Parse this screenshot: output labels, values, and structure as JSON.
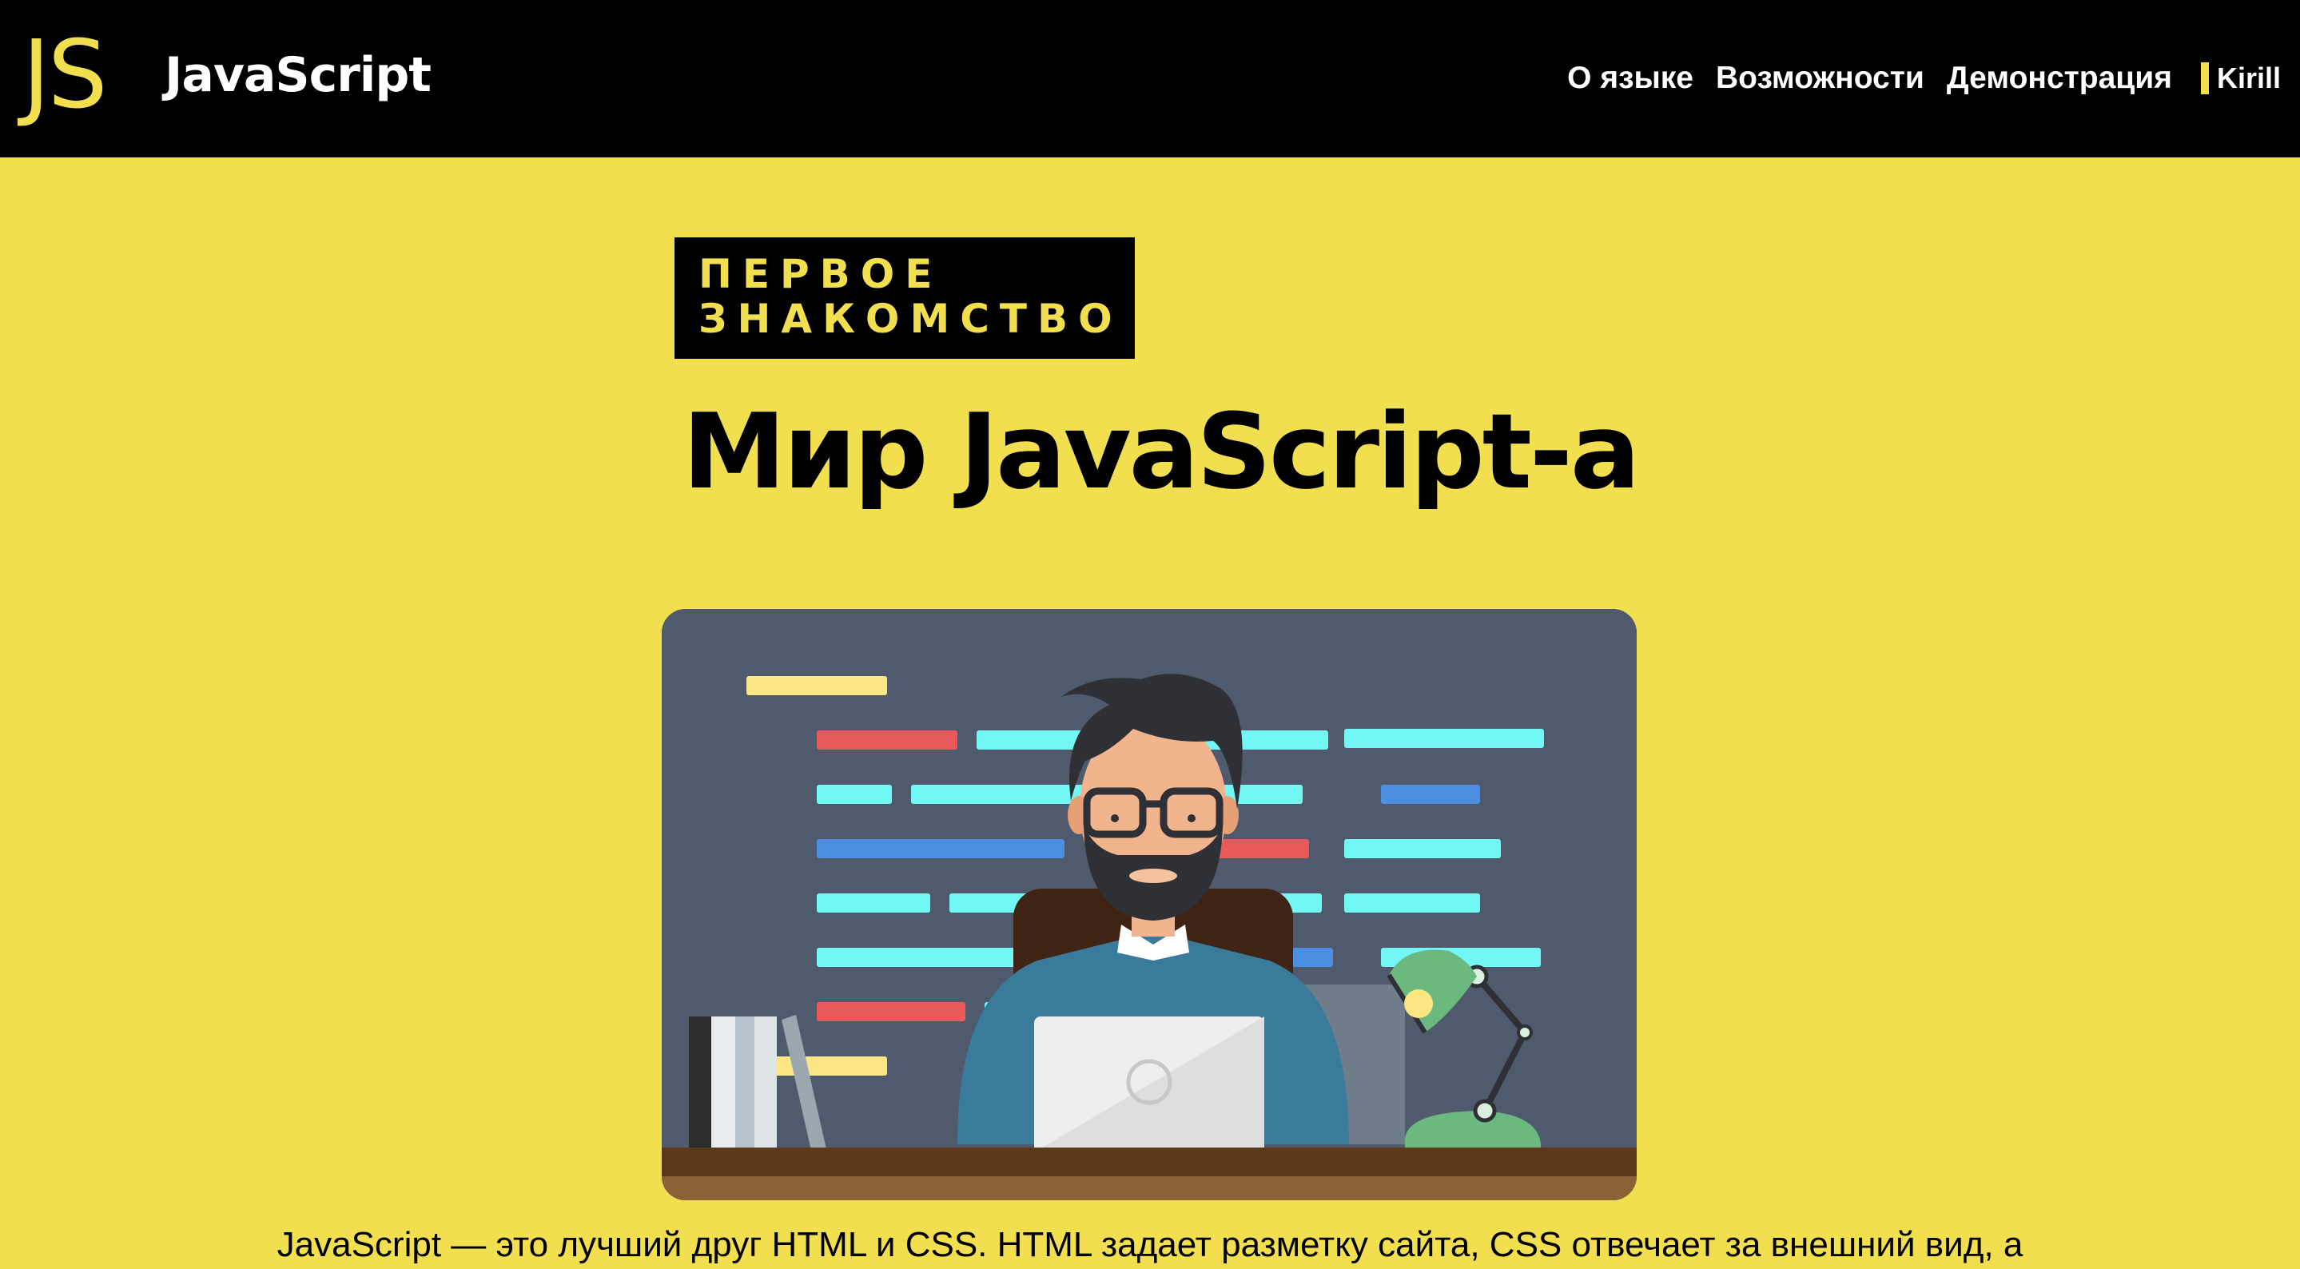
{
  "header": {
    "logo_mark": "JS",
    "logo_text": "JavaScript",
    "nav": [
      {
        "label": "О языке"
      },
      {
        "label": "Возможности"
      },
      {
        "label": "Демонстрация"
      }
    ],
    "user": {
      "name": "Kirill"
    }
  },
  "hero": {
    "badge_line1": "ПЕРВОЕ",
    "badge_line2": "ЗНАКОМСТВО",
    "title": "Мир JavaScript-а",
    "intro": "JavaScript — это лучший друг HTML и CSS. HTML задает разметку сайта, CSS отвечает за внешний вид, а"
  },
  "colors": {
    "accent": "#f1df4f",
    "header_bg": "#000000",
    "illustration_bg": "#4f5a6c"
  }
}
